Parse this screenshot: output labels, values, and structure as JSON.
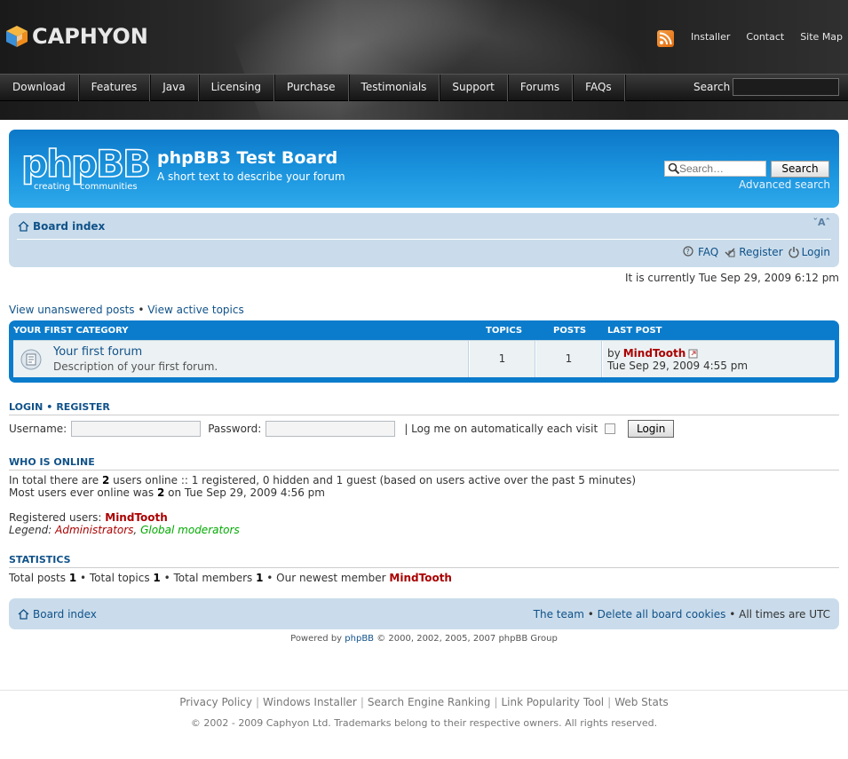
{
  "site": {
    "logo_text": "CAPHYON",
    "top_links": [
      "Installer",
      "Contact",
      "Site Map"
    ],
    "nav": [
      "Download",
      "Features",
      "Java",
      "Licensing",
      "Purchase",
      "Testimonials",
      "Support",
      "Forums",
      "FAQs"
    ],
    "search_label": "Search",
    "search_value": ""
  },
  "board": {
    "title": "phpBB3 Test Board",
    "description": "A short text to describe your forum",
    "logo_main": "phpBB",
    "logo_tagline_1": "creating",
    "logo_tagline_2": "communities",
    "search_placeholder": "Search…",
    "search_button": "Search",
    "advanced_search": "Advanced search"
  },
  "navbar": {
    "board_index": "Board index",
    "font_resize": "ˇAˆ",
    "links": [
      {
        "label": "FAQ",
        "icon": "faq-icon"
      },
      {
        "label": "Register",
        "icon": "register-icon"
      },
      {
        "label": "Login",
        "icon": "login-icon"
      }
    ]
  },
  "current_time": "It is currently Tue Sep 29, 2009 6:12 pm",
  "quick_links": {
    "unanswered": "View unanswered posts",
    "separator": "•",
    "active": "View active topics"
  },
  "category": {
    "name": "YOUR FIRST CATEGORY",
    "col_topics": "TOPICS",
    "col_posts": "POSTS",
    "col_last_post": "LAST POST",
    "forums": [
      {
        "title": "Your first forum",
        "description": "Description of your first forum.",
        "topics": "1",
        "posts": "1",
        "last_post_by": "by",
        "last_post_user": "MindTooth",
        "last_post_date": "Tue Sep 29, 2009 4:55 pm"
      }
    ]
  },
  "login": {
    "title_login": "LOGIN",
    "title_sep": "•",
    "title_register": "REGISTER",
    "username_label": "Username:",
    "username_value": "",
    "password_label": "Password:",
    "password_value": "",
    "autologin_label": "| Log me on automatically each visit",
    "button": "Login"
  },
  "online": {
    "title": "WHO IS ONLINE",
    "line1_a": "In total there are ",
    "line1_b": "2",
    "line1_c": " users online :: 1 registered, 0 hidden and 1 guest (based on users active over the past 5 minutes)",
    "line2_a": "Most users ever online was ",
    "line2_b": "2",
    "line2_c": " on Tue Sep 29, 2009 4:56 pm",
    "registered_label": "Registered users: ",
    "registered_user": "MindTooth",
    "legend_label": "Legend: ",
    "legend_admin": "Administrators",
    "legend_sep": ", ",
    "legend_gm": "Global moderators"
  },
  "stats": {
    "title": "STATISTICS",
    "posts_label": "Total posts ",
    "posts": "1",
    "topics_label": " • Total topics ",
    "topics": "1",
    "members_label": " • Total members ",
    "members": "1",
    "newest_label": " • Our newest member ",
    "newest": "MindTooth"
  },
  "footer": {
    "board_index": "Board index",
    "the_team": "The team",
    "sep": " • ",
    "delete_cookies": "Delete all board cookies",
    "timezone": "All times are UTC",
    "powered_a": "Powered by ",
    "powered_link": "phpBB",
    "powered_b": " © 2000, 2002, 2005, 2007 phpBB Group"
  },
  "site_footer": {
    "links": [
      "Privacy Policy",
      "Windows Installer",
      "Search Engine Ranking",
      "Link Popularity Tool",
      "Web Stats"
    ],
    "copyright": "© 2002 - 2009 Caphyon Ltd. Trademarks belong to their respective owners. All rights reserved."
  },
  "colors": {
    "accent": "#105289",
    "header_blue": "#0c78c8",
    "username_red": "#aa0000",
    "global_mod_green": "#00aa00",
    "navbar_bg": "#cadceb"
  }
}
